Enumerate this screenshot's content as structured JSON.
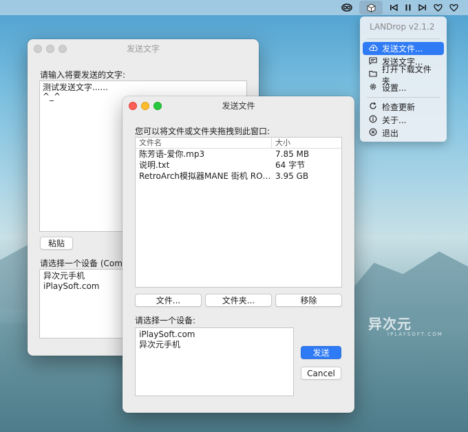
{
  "menubar": {
    "icons": [
      "creative-cloud-icon",
      "landrop-app-icon",
      "previous-track-icon",
      "pause-icon",
      "next-track-icon",
      "heart-icon",
      "heart-icon"
    ]
  },
  "menu": {
    "header": "LANDrop v2.1.2",
    "items": [
      {
        "label": "发送文件...",
        "icon": "cloud-upload-icon"
      },
      {
        "label": "发送文字...",
        "icon": "message-icon"
      },
      {
        "label": "打开下载文件夹",
        "icon": "folder-icon"
      },
      {
        "label": "设置...",
        "icon": "gear-icon"
      },
      {
        "label": "检查更新",
        "icon": "refresh-icon"
      },
      {
        "label": "关于...",
        "icon": "info-icon"
      },
      {
        "label": "退出",
        "icon": "close-circle-icon"
      }
    ]
  },
  "text_window": {
    "title": "发送文字",
    "prompt": "请输入将要发送的文字:",
    "text_line1": "测试发送文字......",
    "text_line2": "^_^",
    "paste_label": "粘贴",
    "device_label": "请选择一个设备 (Comm",
    "devices": [
      "异次元手机",
      "iPlaySoft.com"
    ]
  },
  "file_window": {
    "title": "发送文件",
    "prompt": "您可以将文件或文件夹拖拽到此窗口:",
    "col_name": "文件名",
    "col_size": "大小",
    "files": [
      {
        "name": "陈芳语-爱你.mp3",
        "size": "7.85 MB"
      },
      {
        "name": "说明.txt",
        "size": "64 字节"
      },
      {
        "name": "RetroArch模拟器MANE 街机 ROM...",
        "size": "3.95 GB"
      }
    ],
    "btn_files": "文件...",
    "btn_folder": "文件夹...",
    "btn_remove": "移除",
    "device_label": "请选择一个设备:",
    "devices": [
      "iPlaySoft.com",
      "异次元手机"
    ],
    "btn_send": "发送",
    "btn_cancel": "Cancel"
  },
  "watermark": {
    "main": "异次元",
    "sub": "IPLAYSOFT.COM"
  }
}
